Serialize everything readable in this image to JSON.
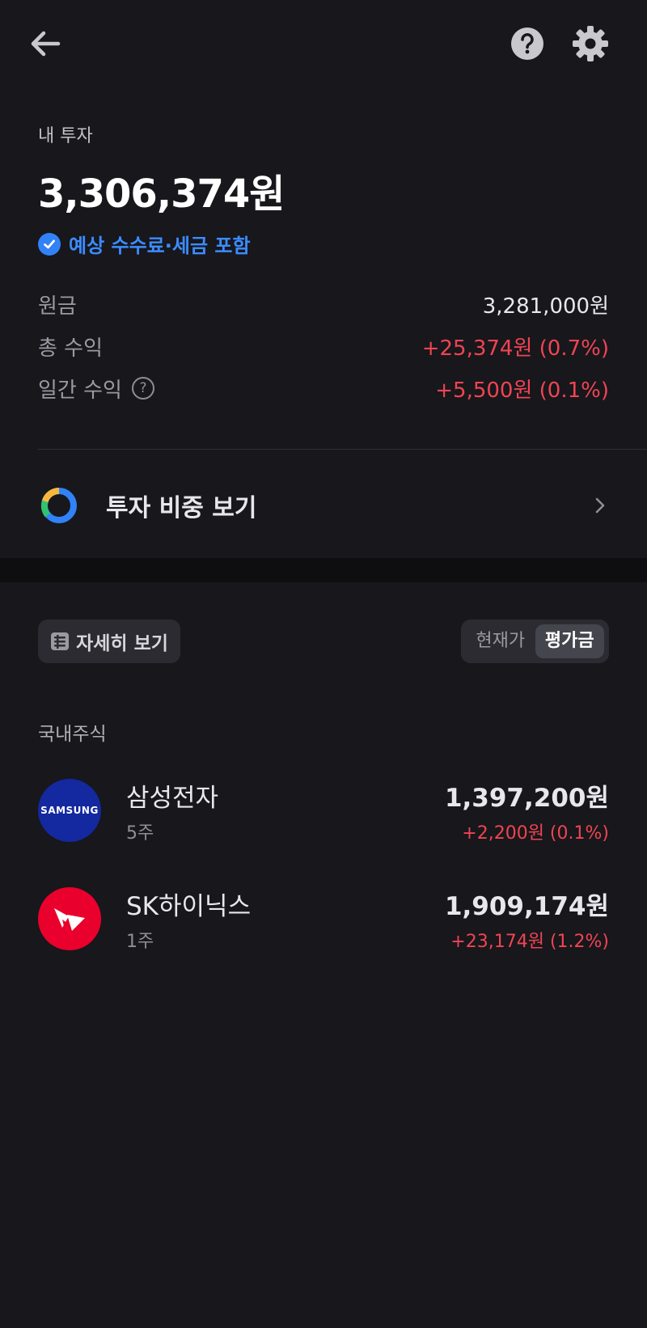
{
  "summary": {
    "label": "내 투자",
    "total": "3,306,374원",
    "fee_note": "예상 수수료·세금 포함"
  },
  "stats": {
    "principal_label": "원금",
    "principal_value": "3,281,000원",
    "total_return_label": "총 수익",
    "total_return_value": "+25,374원 (0.7%)",
    "daily_return_label": "일간 수익",
    "daily_return_value": "+5,500원 (0.1%)",
    "help_glyph": "?"
  },
  "ratio": {
    "label": "투자 비중 보기"
  },
  "controls": {
    "detail_label": "자세히 보기",
    "toggle_options": [
      "현재가",
      "평가금"
    ],
    "toggle_selected": "평가금"
  },
  "section": {
    "domestic_label": "국내주식"
  },
  "stocks": [
    {
      "name": "삼성전자",
      "qty": "5주",
      "value": "1,397,200원",
      "change": "+2,200원 (0.1%)",
      "logo_text": "SAMSUNG",
      "logo_color": "#1428a0"
    },
    {
      "name": "SK하이닉스",
      "qty": "1주",
      "value": "1,909,174원",
      "change": "+23,174원 (1.2%)",
      "logo_color": "#ea002c"
    }
  ],
  "colors": {
    "background": "#17171c",
    "accent_blue": "#3182f6",
    "positive_red": "#f04452"
  },
  "icons": {
    "back": "arrow-left-icon",
    "help": "help-circle-icon",
    "settings": "gear-icon",
    "fee": "check-circle-icon",
    "ratio": "donut-chart-icon",
    "detail": "list-icon",
    "chevron": "chevron-right-icon"
  }
}
